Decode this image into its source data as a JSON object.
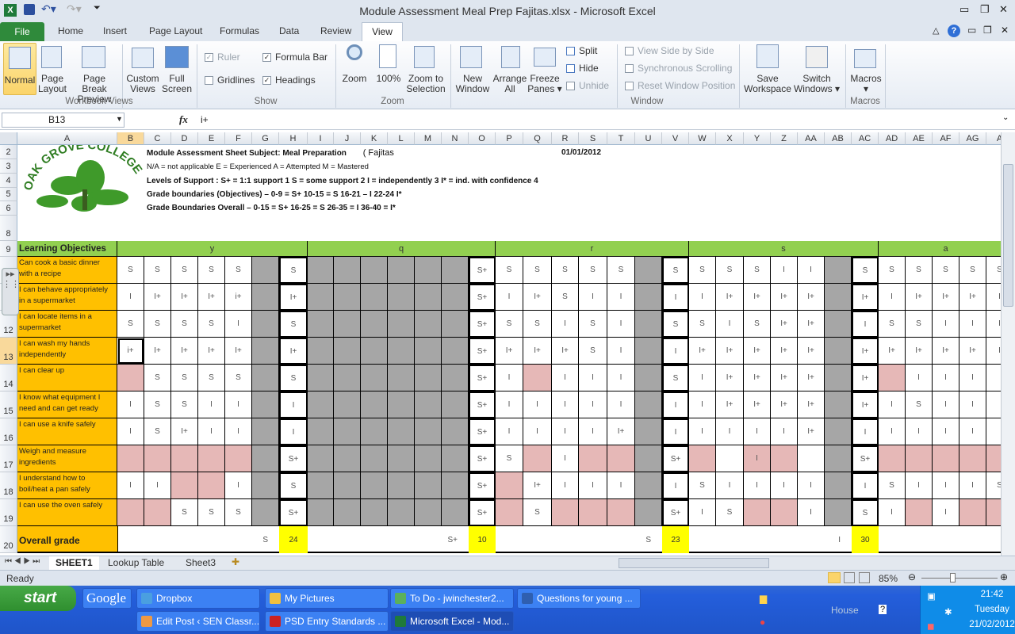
{
  "window": {
    "title": "Module Assessment Meal Prep Fajitas.xlsx  -  Microsoft Excel"
  },
  "ribbon": {
    "tabs": [
      "File",
      "Home",
      "Insert",
      "Page Layout",
      "Formulas",
      "Data",
      "Review",
      "View"
    ],
    "workbook_views": {
      "normal": "Normal",
      "page_layout": [
        "Page",
        "Layout"
      ],
      "page_break": [
        "Page Break",
        "Preview"
      ],
      "custom": [
        "Custom",
        "Views"
      ],
      "full": [
        "Full",
        "Screen"
      ],
      "label": "Workbook Views"
    },
    "show": {
      "ruler": "Ruler",
      "formula_bar": "Formula Bar",
      "gridlines": "Gridlines",
      "headings": "Headings",
      "label": "Show"
    },
    "zoom": {
      "zoom": "Zoom",
      "hundred": "100%",
      "sel": [
        "Zoom to",
        "Selection"
      ],
      "label": "Zoom"
    },
    "window": {
      "new": [
        "New",
        "Window"
      ],
      "arrange": [
        "Arrange",
        "All"
      ],
      "freeze": [
        "Freeze",
        "Panes ▾"
      ],
      "split": "Split",
      "hide": "Hide",
      "unhide": "Unhide",
      "side": "View Side by Side",
      "sync": "Synchronous Scrolling",
      "reset": "Reset Window Position",
      "save": [
        "Save",
        "Workspace"
      ],
      "switch": [
        "Switch",
        "Windows ▾"
      ],
      "label": "Window"
    },
    "macros": {
      "macros": "Macros",
      "arrow": "▾",
      "label": "Macros"
    }
  },
  "formula_bar": {
    "name_box": "B13",
    "fx": "fx",
    "value": "i+"
  },
  "columns": [
    "A",
    "B",
    "C",
    "D",
    "E",
    "F",
    "G",
    "H",
    "I",
    "J",
    "K",
    "L",
    "M",
    "N",
    "O",
    "P",
    "Q",
    "R",
    "S",
    "T",
    "U",
    "V",
    "W",
    "X",
    "Y",
    "Z",
    "AA",
    "AB",
    "AC",
    "AD",
    "AE",
    "AF",
    "AG",
    "A"
  ],
  "row_numbers": [
    "2",
    "3",
    "4",
    "5",
    "6",
    "8",
    "9",
    "10",
    "11",
    "12",
    "13",
    "14",
    "15",
    "16",
    "17",
    "18",
    "19",
    "20"
  ],
  "logo": {
    "text": "OAK GROVE COLLEGE"
  },
  "header": {
    "title": "Module Assessment Sheet    Subject:  Meal Preparation",
    "subtitle": "( Fajitas",
    "date": "01/01/2012",
    "key": "N/A = not applicable   E = Experienced    A = Attempted   M = Mastered",
    "support": "Levels of Support :  S+ = 1:1 support 1  S = some support 2  I = independently  3  I* = ind. with confidence  4",
    "boundaries_obj": "Grade boundaries (Objectives) – 0-9 = S+    10-15 = S     16-21 – I      22-24 I*",
    "boundaries_all": "Grade Boundaries Overall – 0-15 = S+     16-25 = S      26-35 = I      36-40 = I*"
  },
  "objectives_header": "Learning Objectives",
  "groups": [
    "y",
    "q",
    "r",
    "s",
    "a"
  ],
  "objectives": [
    {
      "label": "Can cook a basic dinner with a recipe",
      "cells": [
        "S",
        "S",
        "S",
        "S",
        "S",
        "",
        "S",
        "",
        "",
        "",
        "",
        "",
        "",
        "S+",
        "S",
        "S",
        "S",
        "S",
        "S",
        "",
        "S",
        "S",
        "S",
        "S",
        "I",
        "I",
        "",
        "S",
        "S",
        "S",
        "S",
        "S",
        "S"
      ],
      "pink": []
    },
    {
      "label": "I can behave appropriately in a supermarket",
      "cells": [
        "I",
        "I+",
        "I+",
        "I+",
        "i+",
        "",
        "I+",
        "",
        "",
        "",
        "",
        "",
        "",
        "S+",
        "I",
        "I+",
        "S",
        "I",
        "I",
        "",
        "I",
        "I",
        "I+",
        "I+",
        "I+",
        "I+",
        "",
        "I+",
        "I",
        "I+",
        "I+",
        "I+",
        "I"
      ],
      "pink": []
    },
    {
      "label": "I can locate items in a supermarket",
      "cells": [
        "S",
        "S",
        "S",
        "S",
        "I",
        "",
        "S",
        "",
        "",
        "",
        "",
        "",
        "",
        "S+",
        "S",
        "S",
        "I",
        "S",
        "I",
        "",
        "S",
        "S",
        "I",
        "S",
        "I+",
        "I+",
        "",
        "I",
        "S",
        "S",
        "I",
        "I",
        "I"
      ],
      "pink": []
    },
    {
      "label": "I can wash my hands independently",
      "cells": [
        "i+",
        "I+",
        "I+",
        "I+",
        "I+",
        "",
        "I+",
        "",
        "",
        "",
        "",
        "",
        "",
        "S+",
        "I+",
        "I+",
        "I+",
        "S",
        "I",
        "",
        "I",
        "I+",
        "I+",
        "I+",
        "I+",
        "I+",
        "",
        "I+",
        "I+",
        "I+",
        "I+",
        "I+",
        "I"
      ],
      "pink": []
    },
    {
      "label": "I can clear up",
      "cells": [
        "",
        "S",
        "S",
        "S",
        "S",
        "",
        "S",
        "",
        "",
        "",
        "",
        "",
        "",
        "S+",
        "I",
        "",
        "I",
        "I",
        "I",
        "",
        "S",
        "I",
        "I+",
        "I+",
        "I+",
        "I+",
        "",
        "I+",
        "",
        "I",
        "I",
        "I",
        ""
      ],
      "pink": [
        0,
        15,
        28
      ]
    },
    {
      "label": "I know what equipment I need and can get ready",
      "cells": [
        "I",
        "S",
        "S",
        "I",
        "I",
        "",
        "I",
        "",
        "",
        "",
        "",
        "",
        "",
        "S+",
        "I",
        "I",
        "I",
        "I",
        "I",
        "",
        "I",
        "I",
        "I+",
        "I+",
        "I+",
        "I+",
        "",
        "I+",
        "I",
        "S",
        "I",
        "I",
        ""
      ],
      "pink": []
    },
    {
      "label": "I can use a knife safely",
      "cells": [
        "I",
        "S",
        "I+",
        "I",
        "I",
        "",
        "I",
        "",
        "",
        "",
        "",
        "",
        "",
        "S+",
        "I",
        "I",
        "I",
        "I",
        "I+",
        "",
        "I",
        "I",
        "I",
        "I",
        "I",
        "I+",
        "",
        "I",
        "I",
        "I",
        "I",
        "I",
        ""
      ],
      "pink": []
    },
    {
      "label": "Weigh and measure ingredients",
      "cells": [
        "",
        "",
        "",
        "",
        "",
        "",
        "S+",
        "",
        "",
        "",
        "",
        "",
        "",
        "S+",
        "S",
        "",
        "I",
        "",
        "",
        "",
        "S+",
        "",
        "",
        "I",
        "",
        "",
        "",
        "S+",
        "",
        "",
        "",
        "",
        ""
      ],
      "pink": [
        0,
        1,
        2,
        3,
        4,
        15,
        17,
        18,
        21,
        23,
        24,
        28,
        29,
        30,
        31,
        32
      ]
    },
    {
      "label": "I understand how to boil/heat a pan safely",
      "cells": [
        "I",
        "I",
        "",
        "",
        "I",
        "",
        "S",
        "",
        "",
        "",
        "",
        "",
        "",
        "S+",
        "",
        "I+",
        "I",
        "I",
        "I",
        "",
        "I",
        "S",
        "I",
        "I",
        "I",
        "I",
        "",
        "I",
        "S",
        "I",
        "I",
        "I",
        "S"
      ],
      "pink": [
        2,
        3,
        14
      ]
    },
    {
      "label": "I can use the oven   safely",
      "cells": [
        "",
        "",
        "S",
        "S",
        "S",
        "",
        "S+",
        "",
        "",
        "",
        "",
        "",
        "",
        "S+",
        "",
        "S",
        "",
        "",
        "",
        "",
        "S+",
        "I",
        "S",
        "",
        "",
        "I",
        "",
        "S",
        "I",
        "",
        "I",
        "",
        ""
      ],
      "pink": [
        0,
        1,
        14,
        16,
        17,
        18,
        23,
        24,
        29,
        31,
        32
      ]
    }
  ],
  "overall": {
    "label": "Overall grade",
    "cells": [
      {
        "col": 5,
        "v": "S"
      },
      {
        "col": 6,
        "v": "24",
        "hl": true
      },
      {
        "col": 12,
        "v": "S+"
      },
      {
        "col": 13,
        "v": "10",
        "hl": true
      },
      {
        "col": 19,
        "v": "S"
      },
      {
        "col": 20,
        "v": "23",
        "hl": true
      },
      {
        "col": 26,
        "v": "I"
      },
      {
        "col": 27,
        "v": "30",
        "hl": true
      }
    ]
  },
  "sheets": {
    "tabs": [
      "SHEET1",
      "Lookup Table",
      "Sheet3"
    ],
    "active": "SHEET1"
  },
  "status": {
    "ready": "Ready",
    "zoom": "85%"
  },
  "taskbar": {
    "start": "start",
    "google": "Google",
    "row1": [
      "Dropbox",
      "My Pictures",
      "To Do - jwinchester2...",
      "Questions for young ..."
    ],
    "row2": [
      "Edit Post ‹ SEN Classr...",
      "PSD Entry Standards ...",
      "Microsoft Excel - Mod..."
    ],
    "house": "House",
    "time": "21:42",
    "day": "Tuesday",
    "date": "21/02/2012"
  },
  "colors": {
    "accent": "#ffc000",
    "group": "#92d050",
    "pink": "#e6b8b7",
    "gray": "#a6a6a6",
    "yellow": "#ffff00"
  }
}
